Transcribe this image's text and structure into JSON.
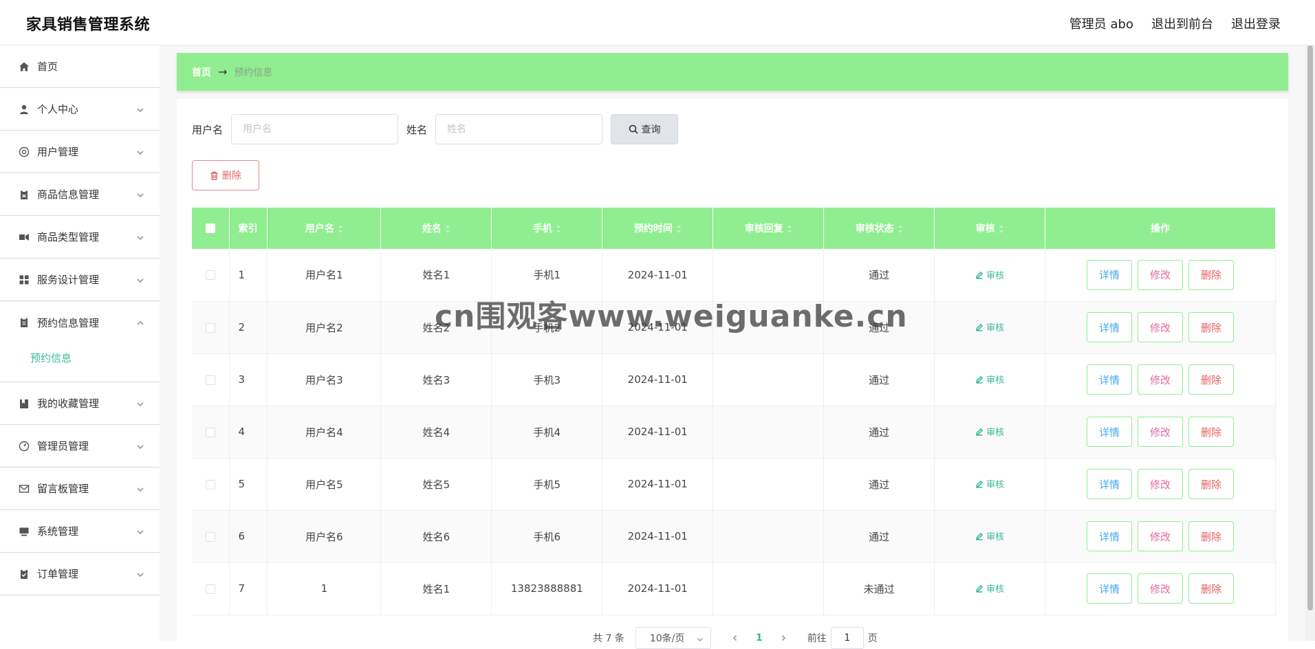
{
  "app": {
    "title": "家具销售管理系统",
    "header_links": {
      "admin": "管理员 abo",
      "front": "退出到前台",
      "logout": "退出登录"
    }
  },
  "sidebar": {
    "items": [
      {
        "label": "首页",
        "icon": "home-icon"
      },
      {
        "label": "个人中心",
        "icon": "user-icon"
      },
      {
        "label": "用户管理",
        "icon": "users-icon"
      },
      {
        "label": "商品信息管理",
        "icon": "clipboard-icon"
      },
      {
        "label": "商品类型管理",
        "icon": "category-icon"
      },
      {
        "label": "服务设计管理",
        "icon": "grid-icon"
      },
      {
        "label": "预约信息管理",
        "icon": "document-icon",
        "expanded": true,
        "sub": [
          {
            "label": "预约信息",
            "active": true
          }
        ]
      },
      {
        "label": "我的收藏管理",
        "icon": "bookmark-icon"
      },
      {
        "label": "管理员管理",
        "icon": "gauge-icon"
      },
      {
        "label": "留言板管理",
        "icon": "mail-icon"
      },
      {
        "label": "系统管理",
        "icon": "monitor-icon"
      },
      {
        "label": "订单管理",
        "icon": "checklist-icon"
      }
    ]
  },
  "breadcrumb": {
    "home": "首页",
    "arrow": "→",
    "current": "预约信息"
  },
  "search": {
    "username_label": "用户名",
    "username_placeholder": "用户名",
    "name_label": "姓名",
    "name_placeholder": "姓名",
    "query_label": "查询"
  },
  "toolbar": {
    "delete_label": "删除"
  },
  "table": {
    "headers": {
      "index": "索引",
      "username": "用户名",
      "name": "姓名",
      "phone": "手机",
      "time": "预约时间",
      "reply": "审核回复",
      "status": "审核状态",
      "audit": "审核",
      "ops": "操作"
    },
    "rows": [
      {
        "index": "1",
        "username": "用户名1",
        "name": "姓名1",
        "phone": "手机1",
        "time": "2024-11-01",
        "reply": "",
        "status": "通过"
      },
      {
        "index": "2",
        "username": "用户名2",
        "name": "姓名2",
        "phone": "手机2",
        "time": "2024-11-01",
        "reply": "",
        "status": "通过"
      },
      {
        "index": "3",
        "username": "用户名3",
        "name": "姓名3",
        "phone": "手机3",
        "time": "2024-11-01",
        "reply": "",
        "status": "通过"
      },
      {
        "index": "4",
        "username": "用户名4",
        "name": "姓名4",
        "phone": "手机4",
        "time": "2024-11-01",
        "reply": "",
        "status": "通过"
      },
      {
        "index": "5",
        "username": "用户名5",
        "name": "姓名5",
        "phone": "手机5",
        "time": "2024-11-01",
        "reply": "",
        "status": "通过"
      },
      {
        "index": "6",
        "username": "用户名6",
        "name": "姓名6",
        "phone": "手机6",
        "time": "2024-11-01",
        "reply": "",
        "status": "通过"
      },
      {
        "index": "7",
        "username": "1",
        "name": "姓名1",
        "phone": "13823888881",
        "time": "2024-11-01",
        "reply": "",
        "status": "未通过"
      }
    ],
    "audit_link": "审核",
    "op_detail": "详情",
    "op_edit": "修改",
    "op_delete": "删除"
  },
  "pagination": {
    "total": "共 7 条",
    "page_size": "10条/页",
    "current_page": "1",
    "goto_label": "前往",
    "goto_value": "1",
    "page_suffix": "页"
  },
  "watermark": "cn围观客www.weiguanke.cn",
  "colors": {
    "accent_green": "#90ee90",
    "link_teal": "#3cb89a",
    "detail_blue": "#44aaee",
    "edit_pink": "#e06aa6",
    "delete_red": "#e36060"
  }
}
